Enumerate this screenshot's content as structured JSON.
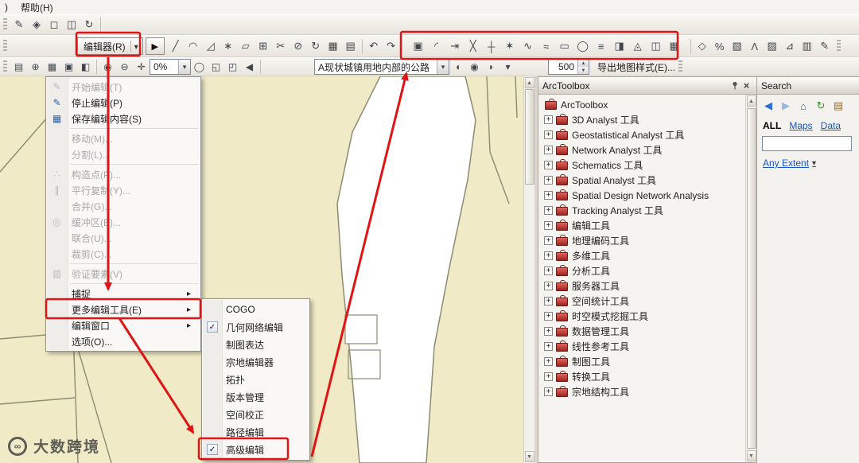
{
  "colors": {
    "annotation_red": "#e01414",
    "map_beige": "#f0ebc6",
    "parcel_line": "#8c8b74",
    "accent_blue": "#1a56c4"
  },
  "menubar": {
    "fragment": ")",
    "help_label": "帮助(H)"
  },
  "toolbar_a": {
    "icons": [
      {
        "name": "editor-pencil-icon",
        "glyph": "✎"
      },
      {
        "name": "snapping-icon",
        "glyph": "◈"
      },
      {
        "name": "select-elements-icon",
        "glyph": "◻"
      },
      {
        "name": "viewer-window-icon",
        "glyph": "◫"
      },
      {
        "name": "refresh-view-icon",
        "glyph": "↻"
      }
    ]
  },
  "toolbar_b": {
    "editor_button_label": "编辑器(R)",
    "arrow_tool_glyph": "▶",
    "edit_icons": [
      {
        "name": "straight-segment-icon",
        "glyph": "╱"
      },
      {
        "name": "arc-segment-icon",
        "glyph": "◠"
      },
      {
        "name": "trace-tool-icon",
        "glyph": "◿"
      },
      {
        "name": "point-tool-icon",
        "glyph": "∗"
      },
      {
        "name": "edit-vertices-icon",
        "glyph": "▱"
      },
      {
        "name": "reshape-feature-icon",
        "glyph": "⊞"
      },
      {
        "name": "cut-polygons-icon",
        "glyph": "✂"
      },
      {
        "name": "split-tool-icon",
        "glyph": "⊘"
      },
      {
        "name": "rotate-tool-icon",
        "glyph": "↻"
      },
      {
        "name": "attributes-icon",
        "glyph": "▦"
      },
      {
        "name": "sketch-properties-icon",
        "glyph": "▤"
      }
    ],
    "undo_redo_icons": [
      {
        "name": "undo-icon",
        "glyph": "↶"
      },
      {
        "name": "redo-icon",
        "glyph": "↷"
      }
    ],
    "advanced_icons": [
      {
        "name": "copy-features-icon",
        "glyph": "▣"
      },
      {
        "name": "fillet-tool-icon",
        "glyph": "◜"
      },
      {
        "name": "extend-tool-icon",
        "glyph": "⇥"
      },
      {
        "name": "trim-tool-icon",
        "glyph": "╳"
      },
      {
        "name": "line-intersection-icon",
        "glyph": "┼"
      },
      {
        "name": "explode-multipart-icon",
        "glyph": "✶"
      },
      {
        "name": "generalize-icon",
        "glyph": "∿"
      },
      {
        "name": "smooth-icon",
        "glyph": "≈"
      },
      {
        "name": "rectangle-tool-icon",
        "glyph": "▭"
      },
      {
        "name": "circle-tool-icon",
        "glyph": "◯"
      },
      {
        "name": "align-edge-icon",
        "glyph": "≡"
      },
      {
        "name": "replace-geometry-icon",
        "glyph": "◨"
      },
      {
        "name": "construct-polygons-icon",
        "glyph": "◬"
      },
      {
        "name": "split-polygons-icon",
        "glyph": "◫"
      },
      {
        "name": "planarize-lines-icon",
        "glyph": "▦"
      }
    ],
    "right_icons": [
      {
        "name": "marker-editing-icon",
        "glyph": "◇"
      },
      {
        "name": "representation-percent-icon",
        "glyph": "%"
      },
      {
        "name": "representation-fill-icon",
        "glyph": "▧"
      },
      {
        "name": "lambda-node-icon",
        "glyph": "Λ"
      },
      {
        "name": "hatch-icon",
        "glyph": "▨"
      },
      {
        "name": "measure-icon",
        "glyph": "⊿"
      },
      {
        "name": "grid-icon",
        "glyph": "▥"
      },
      {
        "name": "pencil-tool-icon",
        "glyph": "✎"
      }
    ]
  },
  "toolbar_c": {
    "icons_a": [
      {
        "name": "table-of-contents-icon",
        "glyph": "▤"
      },
      {
        "name": "add-data-icon",
        "glyph": "⊕"
      },
      {
        "name": "save-icon",
        "glyph": "▦"
      },
      {
        "name": "print-icon",
        "glyph": "▣"
      },
      {
        "name": "catalog-icon",
        "glyph": "◧"
      }
    ],
    "icons_b": [
      {
        "name": "zoom-in-icon",
        "glyph": "◉"
      },
      {
        "name": "zoom-out-icon",
        "glyph": "⊖"
      },
      {
        "name": "pan-icon",
        "glyph": "✛"
      }
    ],
    "transparency_combo": "0%",
    "icons_c": [
      {
        "name": "full-extent-icon",
        "glyph": "◯"
      },
      {
        "name": "fixed-zoom-in-icon",
        "glyph": "◱"
      },
      {
        "name": "fixed-zoom-out-icon",
        "glyph": "◰"
      },
      {
        "name": "previous-extent-icon",
        "glyph": "◀"
      }
    ],
    "layer_combo": "A现状城镇用地内部的公路",
    "icons_d": [
      {
        "name": "route-start-icon",
        "glyph": "◖"
      },
      {
        "name": "route-point-icon",
        "glyph": "◉"
      },
      {
        "name": "route-end-icon",
        "glyph": "◗"
      },
      {
        "name": "more-options-icon",
        "glyph": "▾"
      }
    ],
    "spinner_value": "500",
    "export_label": "导出地图样式(E)..."
  },
  "editor_menu": {
    "items": [
      {
        "label": "开始编辑(T)",
        "glyph": "✎",
        "disabled": true,
        "name": "menu-item-start-editing"
      },
      {
        "label": "停止编辑(P)",
        "glyph": "✎",
        "name": "menu-item-stop-editing"
      },
      {
        "label": "保存编辑内容(S)",
        "glyph": "▦",
        "name": "menu-item-save-edits"
      },
      {
        "separator": true
      },
      {
        "label": "移动(M)...",
        "disabled": true,
        "name": "menu-item-move"
      },
      {
        "label": "分割(L)...",
        "disabled": true,
        "name": "menu-item-split"
      },
      {
        "separator": true
      },
      {
        "label": "构造点(P)...",
        "glyph": "∴",
        "disabled": true,
        "name": "menu-item-construct-points"
      },
      {
        "label": "平行复制(Y)...",
        "glyph": "∥",
        "disabled": true,
        "name": "menu-item-copy-parallel"
      },
      {
        "label": "合并(G)...",
        "disabled": true,
        "name": "menu-item-merge"
      },
      {
        "label": "缓冲区(B)...",
        "glyph": "◎",
        "disabled": true,
        "name": "menu-item-buffer"
      },
      {
        "label": "联合(U)...",
        "disabled": true,
        "name": "menu-item-union"
      },
      {
        "label": "裁剪(C)...",
        "disabled": true,
        "name": "menu-item-clip"
      },
      {
        "separator": true
      },
      {
        "label": "验证要素(V)",
        "glyph": "▥",
        "disabled": true,
        "name": "menu-item-validate-features"
      },
      {
        "separator": true
      },
      {
        "label": "捕捉",
        "submenu": true,
        "name": "menu-item-snapping"
      },
      {
        "label": "更多编辑工具(E)",
        "submenu": true,
        "annotated": true,
        "name": "menu-item-more-editing-tools"
      },
      {
        "label": "编辑窗口",
        "submenu": true,
        "name": "menu-item-editing-windows"
      },
      {
        "label": "选项(O)...",
        "name": "menu-item-options"
      }
    ]
  },
  "more_tools_submenu": {
    "items": [
      {
        "label": "COGO",
        "name": "submenu-item-cogo"
      },
      {
        "label": "几何网络编辑",
        "checked": true,
        "name": "submenu-item-geometric-network-editing"
      },
      {
        "label": "制图表达",
        "name": "submenu-item-representation"
      },
      {
        "label": "宗地编辑器",
        "name": "submenu-item-parcel-editor"
      },
      {
        "label": "拓扑",
        "name": "submenu-item-topology"
      },
      {
        "label": "版本管理",
        "name": "submenu-item-versioning"
      },
      {
        "label": "空间校正",
        "name": "submenu-item-spatial-adjustment"
      },
      {
        "label": "路径编辑",
        "name": "submenu-item-route-editing"
      },
      {
        "label": "高级编辑",
        "checked": true,
        "annotated": true,
        "name": "submenu-item-advanced-editing"
      }
    ]
  },
  "arctoolbox": {
    "title": "ArcToolbox",
    "root_label": "ArcToolbox",
    "toolboxes": [
      "3D Analyst 工具",
      "Geostatistical Analyst 工具",
      "Network Analyst 工具",
      "Schematics 工具",
      "Spatial Analyst 工具",
      "Spatial Design Network Analysis",
      "Tracking Analyst 工具",
      "编辑工具",
      "地理编码工具",
      "多维工具",
      "分析工具",
      "服务器工具",
      "空间统计工具",
      "时空模式挖掘工具",
      "数据管理工具",
      "线性参考工具",
      "制图工具",
      "转换工具",
      "宗地结构工具"
    ]
  },
  "search_panel": {
    "title": "Search",
    "toolbar_icons": [
      {
        "name": "back-icon",
        "glyph": "◀",
        "color": "#2a6fd6"
      },
      {
        "name": "forward-icon",
        "glyph": "▶",
        "color": "#9ab6e0"
      },
      {
        "name": "home-icon",
        "glyph": "⌂",
        "color": "#355f9e"
      },
      {
        "name": "refresh-icon",
        "glyph": "↻",
        "color": "#2f8f2f"
      },
      {
        "name": "index-icon",
        "glyph": "▤",
        "color": "#8a6d3b"
      }
    ],
    "tabs": [
      {
        "label": "ALL",
        "active": true,
        "name": "tab-all"
      },
      {
        "label": "Maps",
        "name": "tab-maps"
      },
      {
        "label": "Data",
        "name": "tab-data"
      }
    ],
    "input_value": "",
    "extent_label": "Any Extent"
  },
  "watermark": {
    "logo_glyph": "∞",
    "text": "大数跨境"
  }
}
